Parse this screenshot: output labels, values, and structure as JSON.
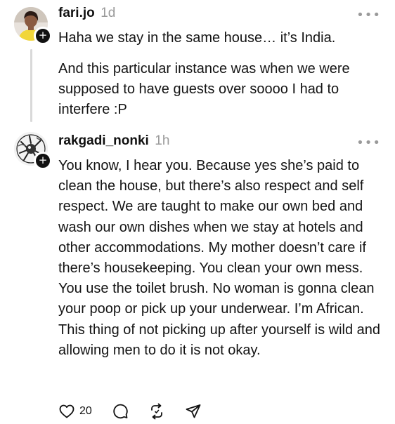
{
  "posts": [
    {
      "username": "fari.jo",
      "time": "1d",
      "avatar_icon": "profile-photo-woman-yellow-top",
      "paragraphs": [
        "Haha we stay in the same house… it’s India.",
        "And this particular instance was when we were supposed to have guests over soooo I had to interfere :P"
      ]
    },
    {
      "username": "rakgadi_nonki",
      "time": "1h",
      "avatar_icon": "profile-photo-bw-illustration",
      "paragraphs": [
        "You know, I hear you. Because yes she’s paid to clean the house, but there’s also respect and self respect. We are taught to make our own bed and wash our own dishes when we stay at hotels and other accommodations. My mother doesn’t care if there’s housekeeping. You clean your own mess. You use the toilet brush. No woman is gonna clean your poop or pick up your underwear. I’m African. This thing of not picking up after yourself is wild and allowing men to do it is not okay."
      ],
      "actions": {
        "like_count": "20",
        "icons": [
          "heart-icon",
          "comment-icon",
          "repost-icon",
          "share-icon"
        ]
      }
    }
  ],
  "ui": {
    "more_glyph": "•••",
    "plus_glyph": "+"
  },
  "colors": {
    "text": "#141414",
    "muted": "#9a9a9a",
    "thread_line": "#d9d9d9"
  }
}
